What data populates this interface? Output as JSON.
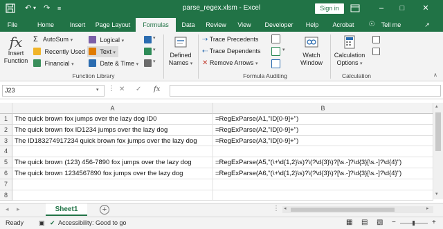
{
  "window": {
    "doc_title": "parse_regex.xlsm  -  Excel",
    "signin_label": "Sign in",
    "colors": {
      "brand": "#217346",
      "ribbon_bg": "#f3f3f3"
    }
  },
  "tabs": [
    "File",
    "Home",
    "Insert",
    "Page Layout",
    "Formulas",
    "Data",
    "Review",
    "View",
    "Developer",
    "Help",
    "Acrobat",
    "Tell me"
  ],
  "active_tab": "Formulas",
  "ribbon": {
    "insert_function": [
      "Insert",
      "Function"
    ],
    "autosum": "AutoSum",
    "recently_used": "Recently Used",
    "financial": "Financial",
    "logical": "Logical",
    "text": "Text",
    "date_time": "Date & Time",
    "defined_names": [
      "Defined",
      "Names"
    ],
    "trace_precedents": "Trace Precedents",
    "trace_dependents": "Trace Dependents",
    "remove_arrows": "Remove Arrows",
    "watch_window": [
      "Watch",
      "Window"
    ],
    "calc_options": [
      "Calculation",
      "Options"
    ],
    "groups": {
      "function_library": "Function Library",
      "formula_auditing": "Formula Auditing",
      "calculation": "Calculation"
    }
  },
  "formula_bar": {
    "name_box": "J23",
    "formula": "",
    "fx_label": "fx"
  },
  "grid": {
    "columns": [
      "A",
      "B"
    ],
    "rows": [
      {
        "n": "1",
        "a": "The quick brown fox jumps over the lazy dog ID0",
        "b": "=RegExParse(A1,\"ID[0-9]+\")"
      },
      {
        "n": "2",
        "a": "The quick brown fox ID1234 jumps over the lazy dog",
        "b": "=RegExParse(A2,\"ID[0-9]+\")"
      },
      {
        "n": "3",
        "a": "The ID183274917234 quick brown fox jumps over the lazy dog",
        "b": "=RegExParse(A3,\"ID[0-9]+\")"
      },
      {
        "n": "4",
        "a": "",
        "b": ""
      },
      {
        "n": "5",
        "a": "The quick brown (123) 456-7890 fox jumps over the lazy dog",
        "b": "=RegExParse(A5,\"(\\+\\d{1,2}\\s)?\\(?\\d{3}\\)?[\\s.-]?\\d{3}[\\s.-]?\\d{4}\")"
      },
      {
        "n": "6",
        "a": "The quick brown 1234567890 fox jumps over the lazy dog",
        "b": "=RegExParse(A6,\"(\\+\\d{1,2}\\s)?\\(?\\d{3}\\)?[\\s.-]?\\d{3}[\\s.-]?\\d{4}\")"
      },
      {
        "n": "7",
        "a": "",
        "b": ""
      },
      {
        "n": "8",
        "a": "",
        "b": ""
      }
    ]
  },
  "sheets": {
    "active": "Sheet1"
  },
  "status": {
    "mode": "Ready",
    "accessibility": "Accessibility: Good to go"
  }
}
